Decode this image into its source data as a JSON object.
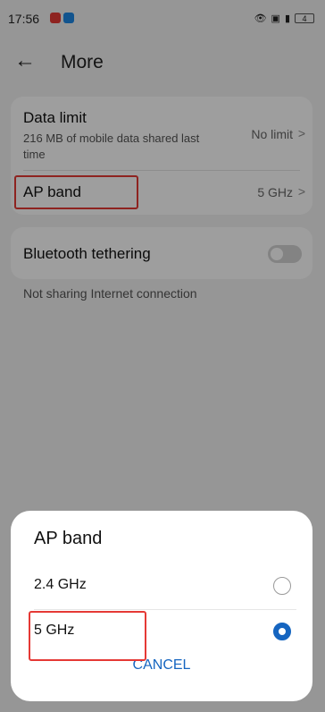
{
  "status_bar": {
    "time": "17:56",
    "right_icons": [
      "eye-icon",
      "nfc-icon",
      "vibrate-icon"
    ],
    "battery": "4"
  },
  "header": {
    "title": "More"
  },
  "settings": {
    "data_limit": {
      "label": "Data limit",
      "description": "216 MB of mobile data shared last time",
      "value": "No limit"
    },
    "ap_band": {
      "label": "AP band",
      "value": "5 GHz"
    },
    "bluetooth_tethering": {
      "label": "Bluetooth tethering",
      "enabled": false
    },
    "note": "Not sharing Internet connection"
  },
  "dialog": {
    "title": "AP band",
    "options": [
      {
        "label": "2.4 GHz",
        "selected": false
      },
      {
        "label": "5 GHz",
        "selected": true
      }
    ],
    "cancel_label": "CANCEL"
  },
  "colors": {
    "accent": "#1565c0",
    "highlight": "#e53935"
  }
}
